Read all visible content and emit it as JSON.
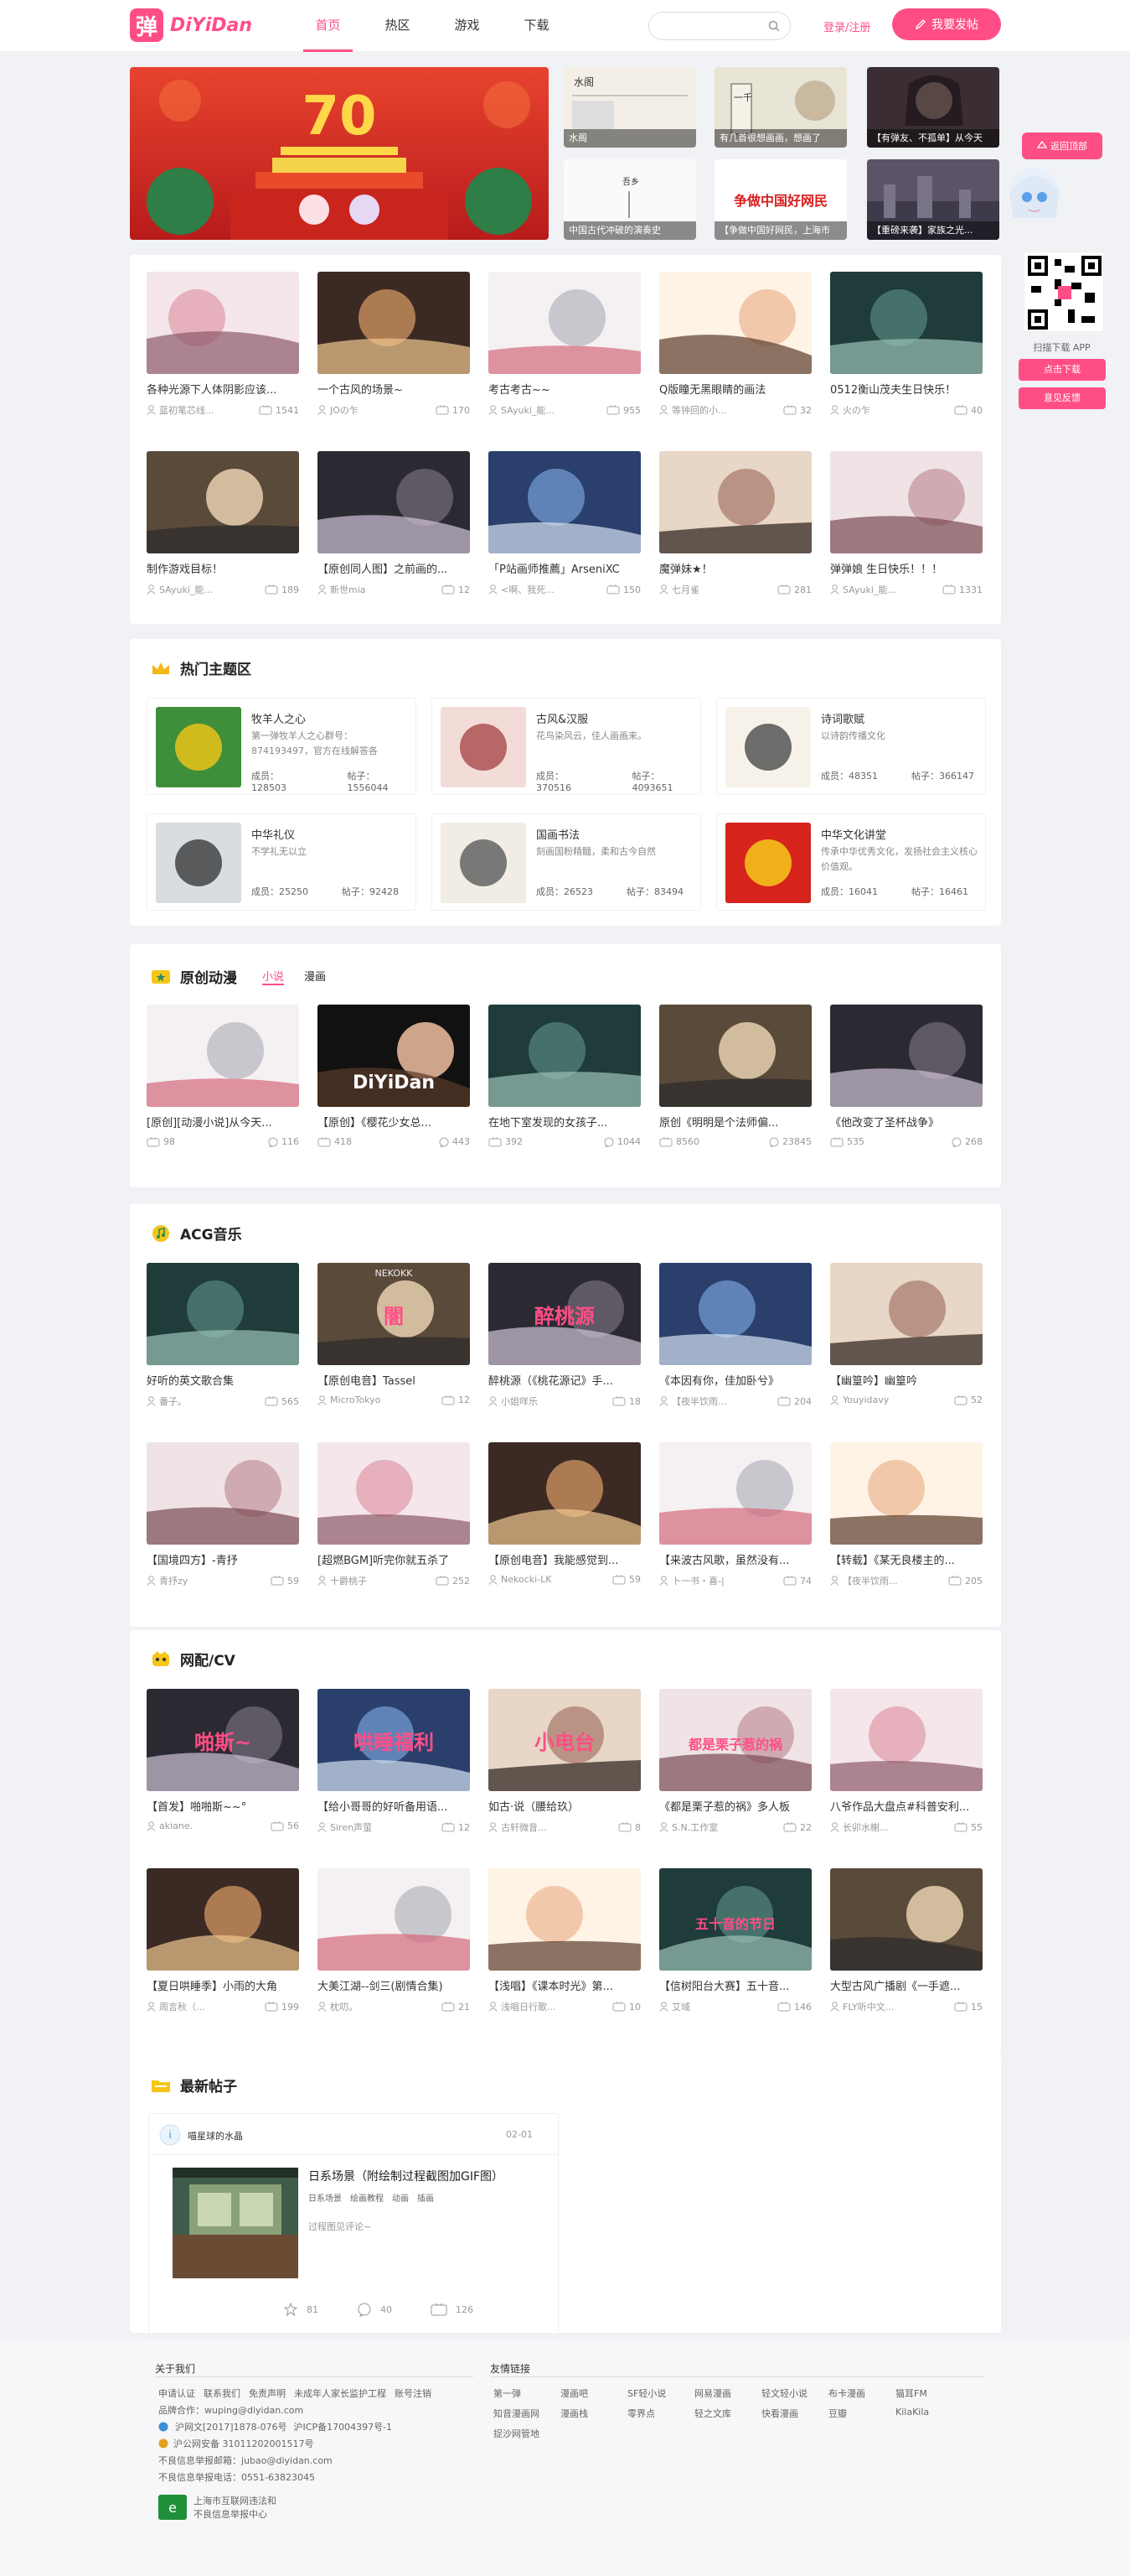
{
  "header": {
    "logo_glyph": "弹",
    "logo_text": "DiYiDan",
    "nav": [
      "首页",
      "热区",
      "游戏",
      "下载"
    ],
    "search_placeholder": "",
    "login": "登录/注册",
    "post_button": "我要发帖"
  },
  "banner": {
    "main_caption": "",
    "thumbs": [
      "水阁",
      "有几首很想画画，想画了",
      "【有弹友、不孤单】从今天",
      "中国古代冲破的演奏史",
      "【争做中国好网民，上海市",
      "【重磅来袭】家族之光..."
    ],
    "thumb_texts": [
      "水阁",
      "一千",
      "",
      "吾乡",
      "争做中国好网民",
      ""
    ]
  },
  "sidebar": {
    "back_label": "返回顶部",
    "scan_label": "扫描下载 APP",
    "download_btn": "点击下载",
    "feedback_btn": "意见反馈"
  },
  "featured": [
    {
      "title": "各种光源下人体阴影应该...",
      "author": "蓝初笔芯线...",
      "views": "1541"
    },
    {
      "title": "一个古风的场景~",
      "author": "JOの乍",
      "views": "170"
    },
    {
      "title": "考古考古~~",
      "author": "SAyuki_能...",
      "views": "955"
    },
    {
      "title": "Q版瞳无黑眼睛的画法",
      "author": "等钟回的小...",
      "views": "32"
    },
    {
      "title": "0512衡山茂夫生日快乐！",
      "author": "火の乍",
      "views": "40"
    },
    {
      "title": "制作游戏目标！",
      "author": "SAyuki_能...",
      "views": "189"
    },
    {
      "title": "【原创同人图】之前画的...",
      "author": "新世mia",
      "views": "12"
    },
    {
      "title": "「P站画师推薦」ArseniXC",
      "author": "<啊、我死...",
      "views": "150"
    },
    {
      "title": "魔弹妹★！",
      "author": "七月雀",
      "views": "281"
    },
    {
      "title": "弹弹娘 生日快乐！！！",
      "author": "SAyuki_能...",
      "views": "1331"
    }
  ],
  "hot": {
    "title": "热门主题区",
    "members_label": "成员：",
    "posts_label": "帖子：",
    "items": [
      {
        "name": "牧羊人之心",
        "desc": "第一弹牧羊人之心群号：874193497，官方在线解答各",
        "members": "128503",
        "posts": "1556044"
      },
      {
        "name": "古风&汉服",
        "desc": "花鸟染风云，佳人画画来。",
        "members": "370516",
        "posts": "4093651"
      },
      {
        "name": "诗词歌赋",
        "desc": "以诗韵传播文化",
        "members": "48351",
        "posts": "366147"
      },
      {
        "name": "中华礼仪",
        "desc": "不学礼无以立",
        "members": "25250",
        "posts": "92428"
      },
      {
        "name": "国画书法",
        "desc": "刻画国粉精髓，柔和古今自然",
        "members": "26523",
        "posts": "83494"
      },
      {
        "name": "中华文化讲堂",
        "desc": "传承中华优秀文化，发扬社会主义核心价值观。",
        "members": "16041",
        "posts": "16461"
      }
    ]
  },
  "original": {
    "title": "原创动漫",
    "tabs": [
      "小说",
      "漫画"
    ],
    "items": [
      {
        "title": "[原创][动漫小说]从今天...",
        "views": "98",
        "comments": "116"
      },
      {
        "title": "【原创】《樱花少女总...",
        "views": "418",
        "comments": "443",
        "logo": "DiYiDan"
      },
      {
        "title": "在地下室发现的女孩子...",
        "views": "392",
        "comments": "1044"
      },
      {
        "title": "原创《明明是个法师偏...",
        "views": "8560",
        "comments": "23845"
      },
      {
        "title": "《他改变了圣杯战争》",
        "views": "535",
        "comments": "268"
      }
    ]
  },
  "music": {
    "title": "ACG音乐",
    "items": [
      {
        "title": "好听的英文歌合集",
        "author": "番子。",
        "views": "565"
      },
      {
        "title": "【原创电音】Tassel",
        "author": "MicroTokyo",
        "views": "12",
        "art": "NEKOKK",
        "glyph": "闇"
      },
      {
        "title": "醉桃源（《桃花源记》手...",
        "author": "小姐咩乐",
        "views": "18",
        "glyph": "醉桃源"
      },
      {
        "title": "《本因有你，佳加卧兮》",
        "author": "【夜半饮雨...",
        "views": "204"
      },
      {
        "title": "【幽篁吟】幽篁吟",
        "author": "Youyidavy",
        "views": "52"
      },
      {
        "title": "【国境四方】-青抒",
        "author": "青抒zy",
        "views": "59"
      },
      {
        "title": "[超燃BGM]听完你就五杀了",
        "author": "十爵桃子",
        "views": "252"
      },
      {
        "title": "【原创电音】我能感觉到...",
        "author": "Nekocki-LK",
        "views": "59"
      },
      {
        "title": "【来波古风歌，虽然没有...",
        "author": "卜一书・喜-|",
        "views": "74"
      },
      {
        "title": "【转载】《某无良楼主的...",
        "author": "【夜半饮雨...",
        "views": "205"
      }
    ]
  },
  "cv": {
    "title": "网配/CV",
    "items": [
      {
        "title": "【首发】啪啪斯~~°",
        "author": "akiane.",
        "views": "56",
        "glyph": "啪斯~"
      },
      {
        "title": "【给小哥哥的好听备用语...",
        "author": "Siren声萤",
        "views": "12",
        "glyph": "哄睡福利"
      },
      {
        "title": "如古·说（腰给玖）",
        "author": "古轩微音...",
        "views": "8",
        "glyph": "小电台"
      },
      {
        "title": "《都是栗子惹的祸》多人板",
        "author": "S.N.工作室",
        "views": "22",
        "glyph": "都是栗子惹的祸"
      },
      {
        "title": "八爷作品大盘点#科普安利...",
        "author": "长卯水榭...",
        "views": "55"
      },
      {
        "title": "【夏日哄睡季】小雨的大角",
        "author": "周言秋（...",
        "views": "199"
      },
      {
        "title": "大美江湖--剑三(剧情合集)",
        "author": "枕叨。",
        "views": "21"
      },
      {
        "title": "【浅唱】《课本时光》第...",
        "author": "浅唱日行歌...",
        "views": "10"
      },
      {
        "title": "【信树阳台大赛】五十音...",
        "author": "艾域",
        "views": "146",
        "glyph": "五十音的节日"
      },
      {
        "title": "大型古风广播剧《一手遮...",
        "author": "FLY听中文...",
        "views": "15"
      }
    ]
  },
  "latest": {
    "title": "最新帖子",
    "user": "喵星球的水晶",
    "date": "02-01",
    "post_title": "日系场景（附绘制过程截图加GIF图）",
    "tags": [
      "日系场景",
      "绘画教程",
      "动画",
      "插画"
    ],
    "comment_text": "过程图见评论~",
    "likes": "81",
    "comments": "40",
    "views": "126"
  },
  "footer": {
    "about_title": "关于我们",
    "about_links": [
      "申请认证",
      "联系我们",
      "免责声明",
      "未成年人家长监护工程",
      "账号注销"
    ],
    "brand_label": "品牌合作：",
    "brand_email": "wuping@diyidan.com",
    "icp1": "沪网文[2017]1878-076号",
    "icp2": "沪ICP备17004397号-1",
    "police": "沪公网安备 31011202001517号",
    "report_email_label": "不良信息举报邮箱：",
    "report_email": "jubao@diyidan.com",
    "report_phone_label": "不良信息举报电话：",
    "report_phone": "0551-63823045",
    "report_center": [
      "上海市互联网违法和",
      "不良信息举报中心"
    ],
    "friends_title": "友情链接",
    "friend_links": [
      "第一弹",
      "漫画吧",
      "SF轻小说",
      "网易漫画",
      "轻文轻小说",
      "布卡漫画",
      "猫耳FM",
      "知音漫画网",
      "漫画栈",
      "零界点",
      "轻之文库",
      "快看漫画",
      "豆瓣",
      "KilaKila",
      "捉沙网管地"
    ]
  }
}
